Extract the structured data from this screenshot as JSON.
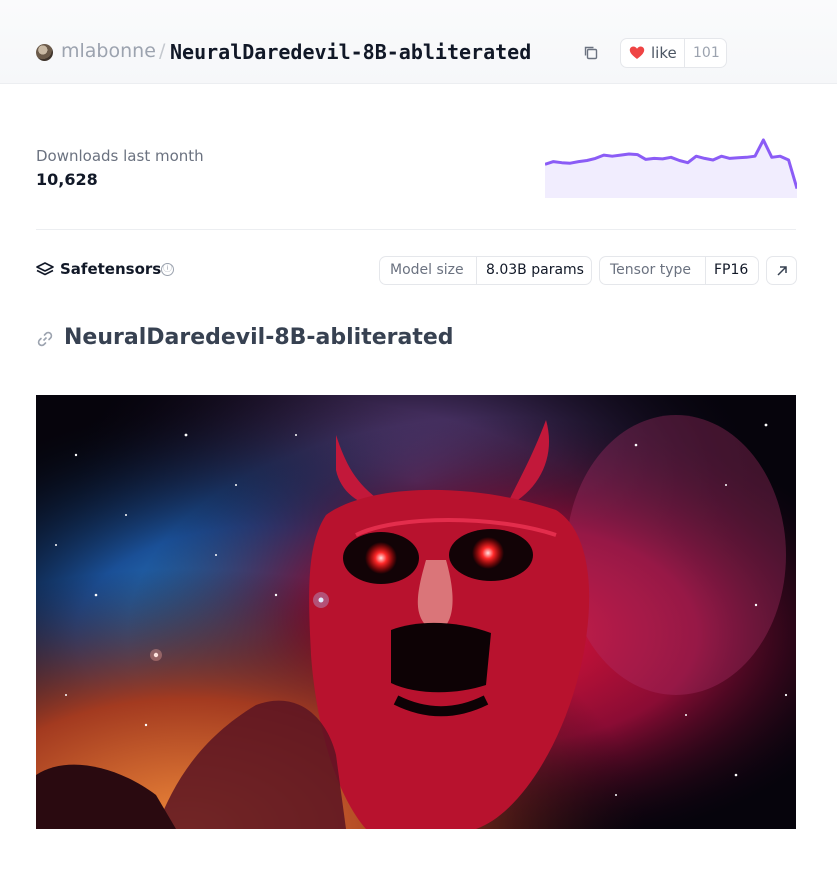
{
  "header": {
    "owner": "mlabonne",
    "separator": "/",
    "repo_name": "NeuralDaredevil-8B-abliterated",
    "like_label": "like",
    "like_count": "101"
  },
  "downloads": {
    "label": "Downloads last month",
    "value": "10,628",
    "trend": [
      0.55,
      0.6,
      0.58,
      0.57,
      0.6,
      0.62,
      0.66,
      0.72,
      0.7,
      0.72,
      0.74,
      0.73,
      0.64,
      0.66,
      0.65,
      0.68,
      0.62,
      0.58,
      0.7,
      0.66,
      0.63,
      0.7,
      0.66,
      0.67,
      0.68,
      0.7,
      1.0,
      0.68,
      0.7,
      0.63,
      0.1
    ],
    "colors": {
      "line": "#8b5cf6",
      "fill": "#ede9fe"
    }
  },
  "safetensors": {
    "label": "Safetensors",
    "info_icon": "ⓘ",
    "model_size_label": "Model size",
    "model_size_value": "8.03B params",
    "tensor_type_label": "Tensor type",
    "tensor_type_value": "FP16"
  },
  "readme": {
    "heading": "NeuralDaredevil-8B-abliterated"
  },
  "icons": {
    "avatar": "avatar",
    "copy": "copy-icon",
    "like": "heart-icon",
    "safetensors": "layers-icon",
    "external": "arrow-up-right-icon",
    "anchor": "link-icon"
  },
  "colors": {
    "accent": "#8b5cf6",
    "heart": "#ef4444"
  }
}
